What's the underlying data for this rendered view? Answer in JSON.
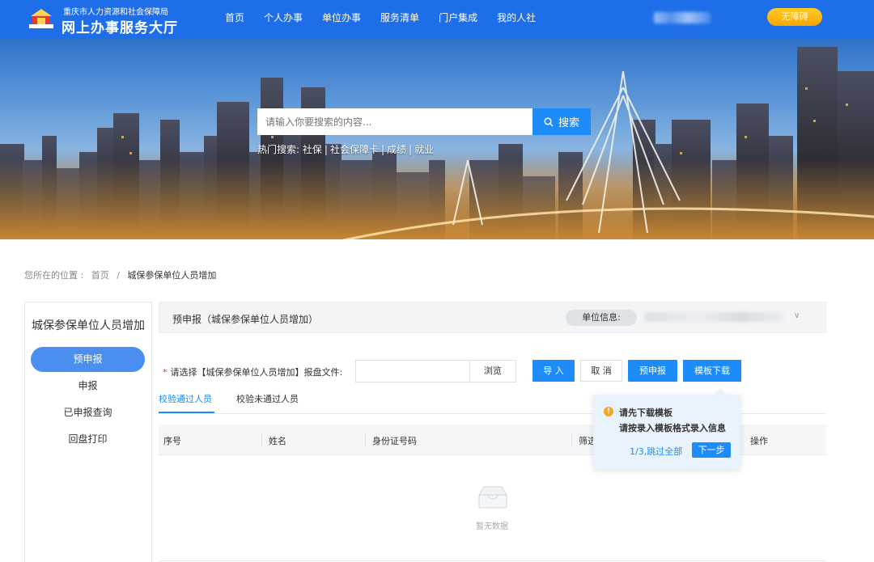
{
  "header": {
    "org_name": "重庆市人力资源和社会保障局",
    "site_name": "网上办事服务大厅",
    "nav": [
      "首页",
      "个人办事",
      "单位办事",
      "服务清单",
      "门户集成",
      "我的人社"
    ],
    "accessibility_label": "无障碍"
  },
  "banner": {
    "search_placeholder": "请输入你要搜索的内容...",
    "search_button": "搜索",
    "hot_label": "热门搜索:",
    "hot_items": [
      "社保",
      "社会保障卡",
      "成绩",
      "就业"
    ]
  },
  "breadcrumb": {
    "prefix": "您所在的位置 :",
    "home": "首页",
    "separator": "/",
    "current": "城保参保单位人员增加"
  },
  "sidebar": {
    "title": "城保参保单位人员增加",
    "items": [
      {
        "label": "预申报",
        "active": true
      },
      {
        "label": "申报",
        "active": false
      },
      {
        "label": "已申报查询",
        "active": false
      },
      {
        "label": "回盘打印",
        "active": false
      }
    ]
  },
  "main": {
    "title": "预申报（城保参保单位人员增加）",
    "unit_info_label": "单位信息:",
    "file_label_required": "*",
    "file_label": "请选择【城保参保单位人员增加】报盘文件:",
    "browse": "浏览",
    "buttons": {
      "import": "导 入",
      "cancel": "取 消",
      "pre_declare": "预申报",
      "template": "模板下载"
    },
    "tabs": [
      "校验通过人员",
      "校验未通过人员"
    ],
    "columns": [
      "序号",
      "姓名",
      "身份证号码",
      "筛选",
      "操作"
    ],
    "empty_text": "暂无数据"
  },
  "popover": {
    "line1": "请先下载模板",
    "line2": "请按录入模板格式录入信息",
    "skip": "1/3,跳过全部",
    "next": "下一步"
  },
  "colors": {
    "header_blue": "#1d6ee8",
    "primary": "#1d8cf8",
    "side_active": "#4a8ff0",
    "access_btn": "#f7a600",
    "warn": "#f5a623"
  }
}
